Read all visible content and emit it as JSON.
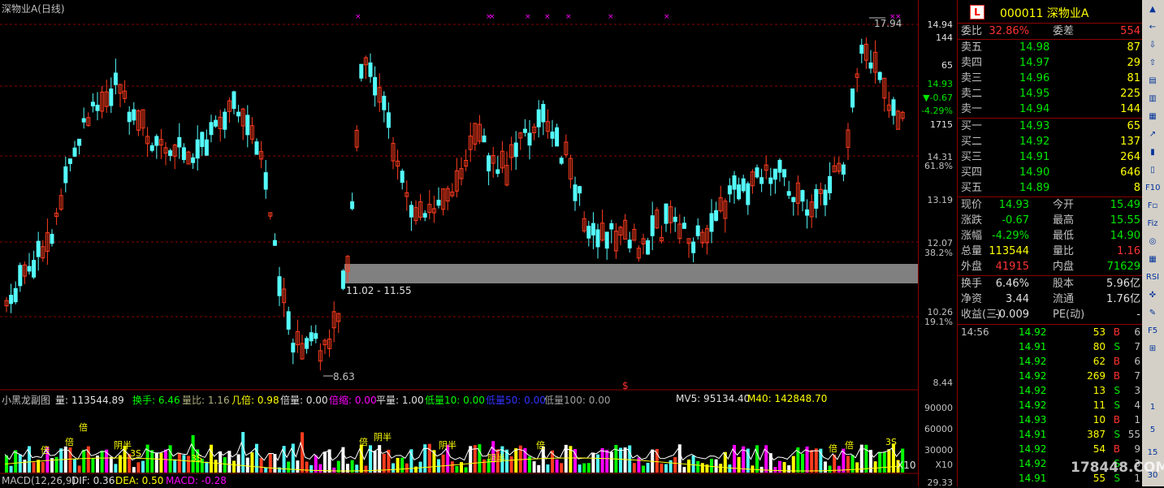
{
  "chart": {
    "title": "深物业A(日线)",
    "high_label": "17.94",
    "low_label": "8.63",
    "zone_label": "11.02 - 11.55",
    "signal_mark": "$",
    "vol_labels": [
      "倍",
      "倍",
      "倍",
      "倍",
      "倍",
      "倍",
      "阴半",
      "阴半",
      "阴半",
      "阴半",
      "3S",
      "3S",
      "3S",
      "倍"
    ],
    "volume_scale": "X10",
    "colors": {
      "up": "#ff3c1e",
      "down": "#54fcfc",
      "grid": "#8b0000",
      "zone": "#808080"
    }
  },
  "price_axis": [
    "14.94",
    "144",
    "65",
    "14.93",
    "▼-0.67",
    "-4.29%",
    "1715",
    "14.31",
    "61.8%",
    "13.19",
    "12.07",
    "38.2%",
    "10.26",
    "19.1%",
    "8.44"
  ],
  "vol_axis": [
    "90000",
    "60000",
    "30000",
    "X10"
  ],
  "macd_axis": [
    "29.33"
  ],
  "indicators": {
    "name": "小黑龙副图",
    "vol": "量: 113544.89",
    "huanshou": "换手: 6.46",
    "liangbi": "量比: 1.16",
    "jibei": "几倍: 0.98",
    "beiliang": "倍量: 0.00",
    "beisuo": "倍缩: 0.00",
    "pingliang": "平量: 1.00",
    "diliang10": "低量10: 0.00",
    "diliang50": "低量50: 0.00",
    "diliang100": "低量100: 0.00",
    "mv5": "MV5: 95134.40",
    "m40": "M40: 142848.70",
    "macd_title": "MACD(12,26,9)",
    "dif": "DIF: 0.36",
    "dea": "DEA: 0.50",
    "macd": "MACD: -0.28"
  },
  "quote": {
    "logo": "L",
    "code_name": "000011 深物业A",
    "weibi_label": "委比",
    "weibi": "32.86%",
    "weicha_label": "委差",
    "weicha": "554",
    "asks": [
      {
        "label": "卖五",
        "price": "14.98",
        "vol": "87"
      },
      {
        "label": "卖四",
        "price": "14.97",
        "vol": "29"
      },
      {
        "label": "卖三",
        "price": "14.96",
        "vol": "81"
      },
      {
        "label": "卖二",
        "price": "14.95",
        "vol": "225"
      },
      {
        "label": "卖一",
        "price": "14.94",
        "vol": "144"
      }
    ],
    "bids": [
      {
        "label": "买一",
        "price": "14.93",
        "vol": "65"
      },
      {
        "label": "买二",
        "price": "14.92",
        "vol": "137"
      },
      {
        "label": "买三",
        "price": "14.91",
        "vol": "264"
      },
      {
        "label": "买四",
        "price": "14.90",
        "vol": "646"
      },
      {
        "label": "买五",
        "price": "14.89",
        "vol": "8"
      }
    ],
    "stats": [
      {
        "l1": "现价",
        "v1": "14.93",
        "c1": "green",
        "l2": "今开",
        "v2": "15.49",
        "c2": "green"
      },
      {
        "l1": "涨跌",
        "v1": "-0.67",
        "c1": "green",
        "l2": "最高",
        "v2": "15.55",
        "c2": "green"
      },
      {
        "l1": "涨幅",
        "v1": "-4.29%",
        "c1": "green",
        "l2": "最低",
        "v2": "14.90",
        "c2": "green"
      },
      {
        "l1": "总量",
        "v1": "113544",
        "c1": "yellow",
        "l2": "量比",
        "v2": "1.16",
        "c2": "red"
      },
      {
        "l1": "外盘",
        "v1": "41915",
        "c1": "red",
        "l2": "内盘",
        "v2": "71629",
        "c2": "green"
      }
    ],
    "fin": [
      {
        "l1": "换手",
        "v1": "6.46%",
        "l2": "股本",
        "v2": "5.96亿"
      },
      {
        "l1": "净资",
        "v1": "3.44",
        "l2": "流通",
        "v2": "1.76亿"
      },
      {
        "l1": "收益(三)",
        "v1": "-0.009",
        "l2": "PE(动)",
        "v2": "-"
      }
    ],
    "ticks": [
      {
        "t": "14:56",
        "p": "14.92",
        "q": "53",
        "s": "B",
        "n": "6"
      },
      {
        "t": "",
        "p": "14.91",
        "q": "80",
        "s": "S",
        "n": "7"
      },
      {
        "t": "",
        "p": "14.92",
        "q": "62",
        "s": "B",
        "n": "6"
      },
      {
        "t": "",
        "p": "14.92",
        "q": "269",
        "s": "B",
        "n": "7"
      },
      {
        "t": "",
        "p": "14.92",
        "q": "13",
        "s": "S",
        "n": "3"
      },
      {
        "t": "",
        "p": "14.92",
        "q": "11",
        "s": "S",
        "n": "4"
      },
      {
        "t": "",
        "p": "14.93",
        "q": "10",
        "s": "B",
        "n": "1"
      },
      {
        "t": "",
        "p": "14.91",
        "q": "387",
        "s": "S",
        "n": "55"
      },
      {
        "t": "",
        "p": "14.92",
        "q": "54",
        "s": "B",
        "n": "9"
      },
      {
        "t": "",
        "p": "14.92",
        "q": "",
        "s": "S",
        "n": "3"
      },
      {
        "t": "",
        "p": "14.91",
        "q": "55",
        "s": "S",
        "n": "1"
      }
    ]
  },
  "toolbar": {
    "items": [
      "▲",
      "←",
      "⇩",
      "⇧",
      "▤",
      "▥",
      "▦",
      "↗",
      "▮",
      "▯",
      "F10",
      "F▫",
      "Fiz",
      "◎",
      "▦",
      "RSI",
      "✜",
      "✎",
      "F5",
      "⊞",
      "1",
      "5",
      "15",
      "30"
    ],
    "icons": [
      "up-arrow-icon",
      "left-arrow-icon",
      "down-icon",
      "up-icon",
      "grid-icon",
      "table-icon",
      "list-icon",
      "trend-icon",
      "candle-icon",
      "bar-icon",
      "f10-icon",
      "f-icon",
      "fiz-icon",
      "circle-icon",
      "grid2-icon",
      "rsi-icon",
      "move-icon",
      "pen-icon",
      "f5-icon",
      "window-icon",
      "period-1",
      "period-5",
      "period-15",
      "period-30"
    ]
  },
  "watermark": "178448.COM"
}
